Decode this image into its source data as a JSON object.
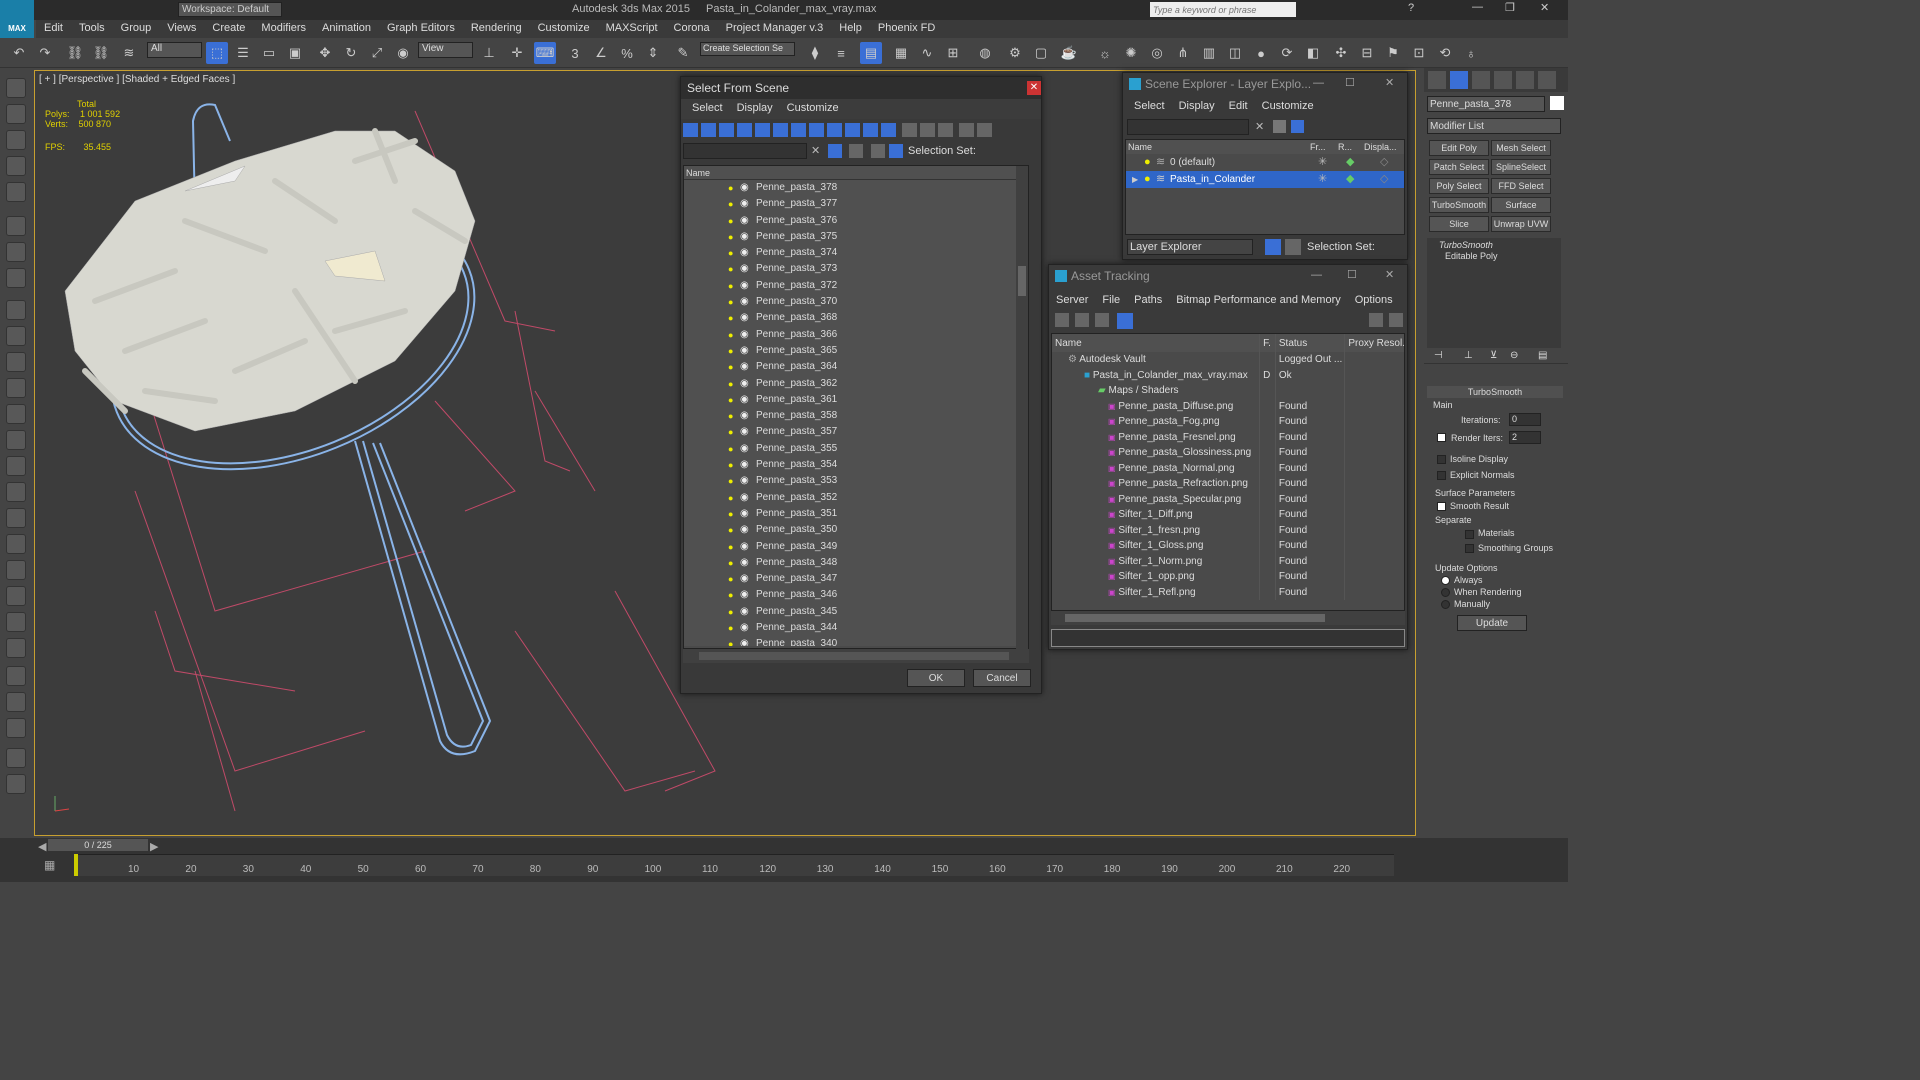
{
  "app": {
    "title": "Autodesk 3ds Max  2015",
    "file": "Pasta_in_Colander_max_vray.max",
    "workspace": "Workspace: Default",
    "search_placeholder": "Type a keyword or phrase"
  },
  "menu": [
    "Edit",
    "Tools",
    "Group",
    "Views",
    "Create",
    "Modifiers",
    "Animation",
    "Graph Editors",
    "Rendering",
    "Customize",
    "MAXScript",
    "Corona",
    "Project Manager v.3",
    "Help",
    "Phoenix FD"
  ],
  "toolbar": {
    "filter": "All",
    "view": "View",
    "selection_set": "Create Selection Se"
  },
  "viewport": {
    "label": "[ + ] [Perspective ] [Shaded + Edged Faces ]",
    "total": "Total",
    "polys_label": "Polys:",
    "polys": "1 001 592",
    "verts_label": "Verts:",
    "verts": "500 870",
    "fps_label": "FPS:",
    "fps": "35.455"
  },
  "select_scene": {
    "title": "Select From Scene",
    "menu": [
      "Select",
      "Display",
      "Customize"
    ],
    "selection_set": "Selection Set:",
    "col_name": "Name",
    "items": [
      "Penne_pasta_378",
      "Penne_pasta_377",
      "Penne_pasta_376",
      "Penne_pasta_375",
      "Penne_pasta_374",
      "Penne_pasta_373",
      "Penne_pasta_372",
      "Penne_pasta_370",
      "Penne_pasta_368",
      "Penne_pasta_366",
      "Penne_pasta_365",
      "Penne_pasta_364",
      "Penne_pasta_362",
      "Penne_pasta_361",
      "Penne_pasta_358",
      "Penne_pasta_357",
      "Penne_pasta_355",
      "Penne_pasta_354",
      "Penne_pasta_353",
      "Penne_pasta_352",
      "Penne_pasta_351",
      "Penne_pasta_350",
      "Penne_pasta_349",
      "Penne_pasta_348",
      "Penne_pasta_347",
      "Penne_pasta_346",
      "Penne_pasta_345",
      "Penne_pasta_344",
      "Penne_pasta_340"
    ],
    "ok": "OK",
    "cancel": "Cancel"
  },
  "scene_explorer": {
    "title": "Scene Explorer - Layer Explo...",
    "menu": [
      "Select",
      "Display",
      "Edit",
      "Customize"
    ],
    "cols": [
      "Name",
      "Fr...",
      "R...",
      "Displa..."
    ],
    "layers": [
      "0 (default)",
      "Pasta_in_Colander"
    ],
    "footer": "Layer Explorer",
    "selection_set": "Selection Set:"
  },
  "asset_tracking": {
    "title": "Asset Tracking",
    "menu": [
      "Server",
      "File",
      "Paths",
      "Bitmap Performance and Memory",
      "Options"
    ],
    "cols": [
      "Name",
      "F.",
      "Status",
      "Proxy Resol."
    ],
    "rows": [
      {
        "name": "Autodesk Vault",
        "f": "",
        "status": "Logged Out ..."
      },
      {
        "name": "Pasta_in_Colander_max_vray.max",
        "f": "D",
        "status": "Ok"
      },
      {
        "name": "Maps / Shaders",
        "f": "",
        "status": ""
      },
      {
        "name": "Penne_pasta_Diffuse.png",
        "f": "",
        "status": "Found"
      },
      {
        "name": "Penne_pasta_Fog.png",
        "f": "",
        "status": "Found"
      },
      {
        "name": "Penne_pasta_Fresnel.png",
        "f": "",
        "status": "Found"
      },
      {
        "name": "Penne_pasta_Glossiness.png",
        "f": "",
        "status": "Found"
      },
      {
        "name": "Penne_pasta_Normal.png",
        "f": "",
        "status": "Found"
      },
      {
        "name": "Penne_pasta_Refraction.png",
        "f": "",
        "status": "Found"
      },
      {
        "name": "Penne_pasta_Specular.png",
        "f": "",
        "status": "Found"
      },
      {
        "name": "Sifter_1_Diff.png",
        "f": "",
        "status": "Found"
      },
      {
        "name": "Sifter_1_fresn.png",
        "f": "",
        "status": "Found"
      },
      {
        "name": "Sifter_1_Gloss.png",
        "f": "",
        "status": "Found"
      },
      {
        "name": "Sifter_1_Norm.png",
        "f": "",
        "status": "Found"
      },
      {
        "name": "Sifter_1_opp.png",
        "f": "",
        "status": "Found"
      },
      {
        "name": "Sifter_1_Refl.png",
        "f": "",
        "status": "Found"
      }
    ]
  },
  "modify": {
    "object": "Penne_pasta_378",
    "modifier_list": "Modifier List",
    "buttons": [
      "Edit Poly",
      "Mesh Select",
      "Patch Select",
      "SplineSelect",
      "Poly Select",
      "FFD Select",
      "TurboSmooth",
      "Surface Select",
      "Slice",
      "Unwrap UVW"
    ],
    "stack": [
      "TurboSmooth",
      "Editable Poly"
    ],
    "rollout": "TurboSmooth",
    "main": "Main",
    "iterations_label": "Iterations:",
    "iterations": "0",
    "render_iters_label": "Render Iters:",
    "render_iters": "2",
    "isoline": "Isoline Display",
    "explicit": "Explicit Normals",
    "surface": "Surface Parameters",
    "smooth": "Smooth Result",
    "separate": "Separate",
    "materials": "Materials",
    "smoothing": "Smoothing Groups",
    "update_opts": "Update Options",
    "always": "Always",
    "when_rendering": "When Rendering",
    "manually": "Manually",
    "update": "Update"
  },
  "timeline": {
    "frame": "0 / 225",
    "ticks": [
      "10",
      "20",
      "30",
      "40",
      "50",
      "60",
      "70",
      "80",
      "90",
      "100",
      "110",
      "120",
      "130",
      "140",
      "150",
      "160",
      "170",
      "180",
      "190",
      "200",
      "210",
      "220"
    ]
  },
  "colors": {
    "accent": "#3a6fd6",
    "wire": "#8ab4e8",
    "selected": "#2f66c8"
  }
}
